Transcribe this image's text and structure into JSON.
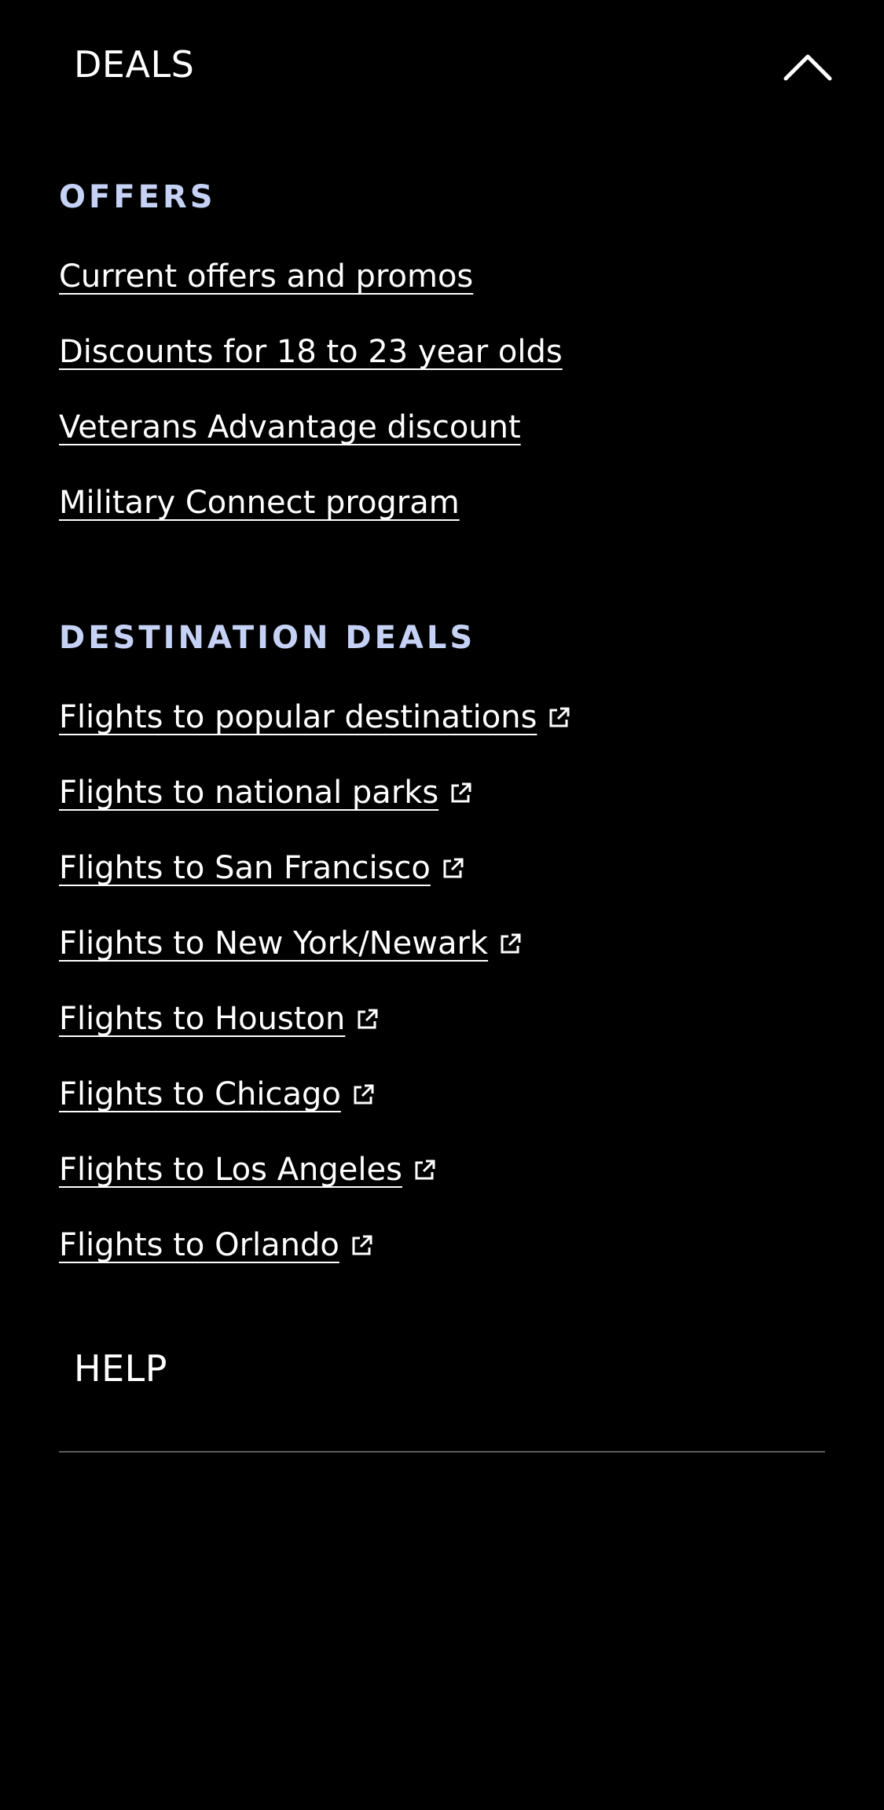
{
  "deals": {
    "title": "DEALS",
    "toggle_icon": "chevron-up-icon",
    "expanded": true
  },
  "offers": {
    "heading": "OFFERS",
    "links": [
      {
        "label": "Current offers and promos"
      },
      {
        "label": "Discounts for 18 to 23 year olds"
      },
      {
        "label": "Veterans Advantage discount"
      },
      {
        "label": "Military Connect program"
      }
    ]
  },
  "destination_deals": {
    "heading": "DESTINATION DEALS",
    "links": [
      {
        "label": "Flights to popular destinations",
        "icon": "external-link-icon"
      },
      {
        "label": "Flights to national parks",
        "icon": "external-link-icon"
      },
      {
        "label": "Flights to San Francisco",
        "icon": "external-link-icon"
      },
      {
        "label": "Flights to New York/Newark",
        "icon": "external-link-icon"
      },
      {
        "label": "Flights to Houston",
        "icon": "external-link-icon"
      },
      {
        "label": "Flights to Chicago",
        "icon": "external-link-icon"
      },
      {
        "label": "Flights to Los Angeles",
        "icon": "external-link-icon"
      },
      {
        "label": "Flights to Orlando",
        "icon": "external-link-icon"
      }
    ]
  },
  "help": {
    "title": "HELP"
  },
  "colors": {
    "background": "#000000",
    "text": "#ffffff",
    "section_heading": "#c5d2f5",
    "divider": "#5c5c5c"
  }
}
